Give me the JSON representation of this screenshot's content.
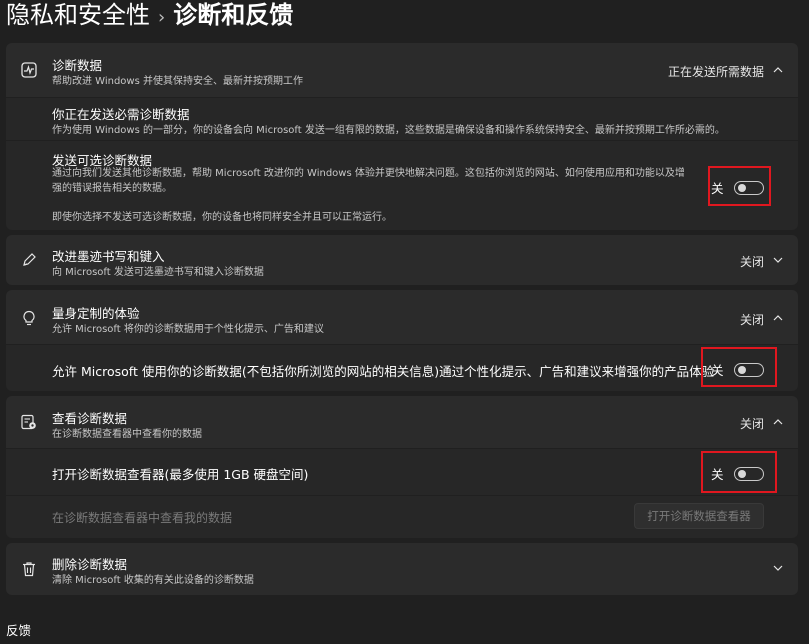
{
  "breadcrumb": {
    "parent": "隐私和安全性",
    "separator": "›",
    "current": "诊断和反馈"
  },
  "diagnostic": {
    "title": "诊断数据",
    "desc": "帮助改进 Windows 并使其保持安全、最新并按预期工作",
    "status": "正在发送所需数据",
    "required": {
      "title": "你正在发送必需诊断数据",
      "desc": "作为使用 Windows 的一部分，你的设备会向 Microsoft 发送一组有限的数据，这些数据是确保设备和操作系统保持安全、最新并按预期工作所必需的。"
    },
    "optional": {
      "title": "发送可选诊断数据",
      "desc": "通过向我们发送其他诊断数据，帮助 Microsoft 改进你的 Windows 体验并更快地解决问题。这包括你浏览的网站、如何使用应用和功能以及增强的错误报告相关的数据。",
      "note": "即使你选择不发送可选诊断数据，你的设备也将同样安全并且可以正常运行。",
      "toggle_label": "关"
    }
  },
  "inking": {
    "title": "改进墨迹书写和键入",
    "desc": "向 Microsoft 发送可选墨迹书写和键入诊断数据",
    "status": "关闭"
  },
  "tailored": {
    "title": "量身定制的体验",
    "desc": "允许 Microsoft 将你的诊断数据用于个性化提示、广告和建议",
    "status": "关闭",
    "sub_text": "允许 Microsoft 使用你的诊断数据(不包括你所浏览的网站的相关信息)通过个性化提示、广告和建议来增强你的产品体验",
    "toggle_label": "关"
  },
  "viewer": {
    "title": "查看诊断数据",
    "desc": "在诊断数据查看器中查看你的数据",
    "status": "关闭",
    "sub_text": "打开诊断数据查看器(最多使用 1GB 硬盘空间)",
    "toggle_label": "关",
    "view_text": "在诊断数据查看器中查看我的数据",
    "open_button": "打开诊断数据查看器"
  },
  "delete": {
    "title": "删除诊断数据",
    "desc": "清除 Microsoft 收集的有关此设备的诊断数据"
  },
  "footer": {
    "feedback": "反馈"
  }
}
